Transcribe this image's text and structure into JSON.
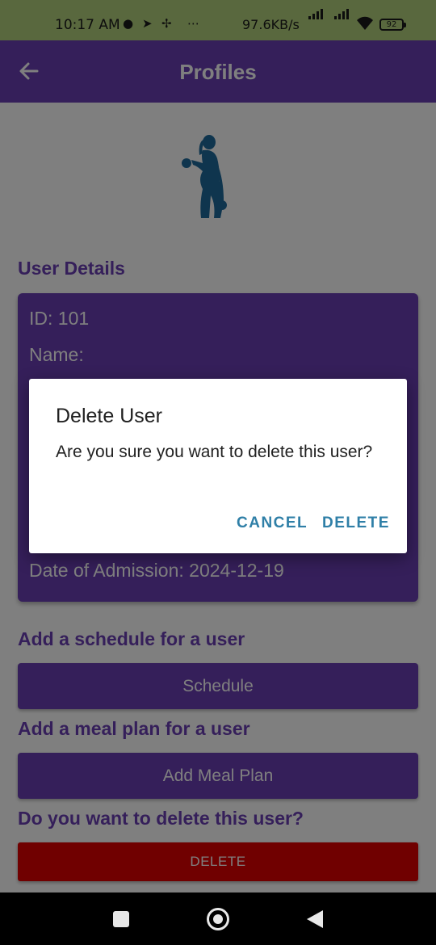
{
  "status_bar": {
    "time": "10:17 AM",
    "notification_icons": [
      "chat-bubble-icon",
      "telegram-icon",
      "pinwheel-icon",
      "more-dots-icon"
    ],
    "net_speed": "97.6KB/s",
    "battery": "92",
    "background": "#b3d07c"
  },
  "app_bar": {
    "title": "Profiles",
    "back_icon": "arrow-left-icon",
    "background": "#6a3eb4"
  },
  "profile": {
    "logo_icon": "fitness-woman-dumbbell-icon",
    "user_details_heading": "User Details",
    "id_line": "ID: 101",
    "name_line": "Name:",
    "admission_line": "Date of Admission: 2024-12-19"
  },
  "schedule_section": {
    "heading": "Add a schedule for a user",
    "button_label": "Schedule"
  },
  "meal_section": {
    "heading": "Add a meal plan for a user",
    "button_label": "Add Meal Plan"
  },
  "delete_section": {
    "heading": "Do you want to delete this user?",
    "button_label": "DELETE",
    "button_color": "#e00000"
  },
  "dialog": {
    "title": "Delete User",
    "message": "Are you sure you want to delete this user?",
    "cancel_label": "CANCEL",
    "delete_label": "DELETE",
    "button_color": "#2f7fa7"
  },
  "nav_bar": {
    "icons": [
      "recents-square-icon",
      "home-circle-icon",
      "back-triangle-icon"
    ]
  }
}
